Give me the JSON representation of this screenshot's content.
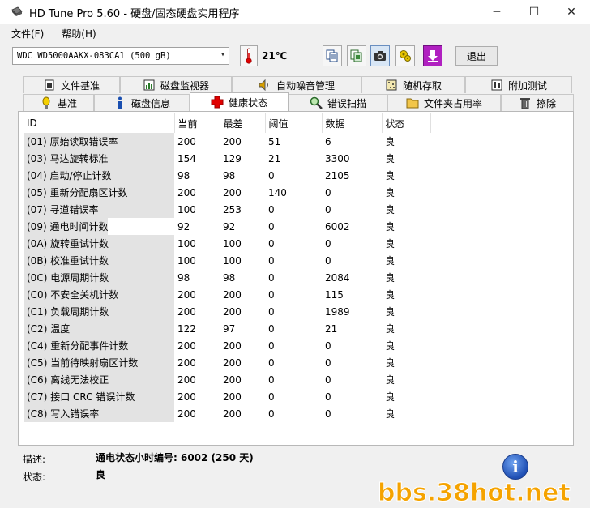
{
  "window": {
    "title": "HD Tune Pro 5.60 - 硬盘/固态硬盘实用程序",
    "minimize": "─",
    "maximize": "☐",
    "close": "✕"
  },
  "menu": [
    "文件(F)",
    "帮助(H)"
  ],
  "toolbar": {
    "drive": "WDC WD5000AAKX-083CA1 (500 gB)",
    "temperature": "21℃",
    "exit_label": "退出",
    "icons": [
      "copy-text-icon",
      "copy-screen-icon",
      "screenshot-icon",
      "options-icon",
      "save-icon"
    ]
  },
  "tabs_top": [
    {
      "label": "文件基准",
      "icon": "file-benchmark-icon"
    },
    {
      "label": "磁盘监视器",
      "icon": "disk-monitor-icon"
    },
    {
      "label": "自动噪音管理",
      "icon": "speaker-icon"
    },
    {
      "label": "随机存取",
      "icon": "random-access-icon"
    },
    {
      "label": "附加测试",
      "icon": "extra-tests-icon"
    }
  ],
  "tabs_bottom": [
    {
      "label": "基准",
      "icon": "benchmark-icon"
    },
    {
      "label": "磁盘信息",
      "icon": "info-icon"
    },
    {
      "label": "健康状态",
      "icon": "health-cross-icon",
      "active": true
    },
    {
      "label": "错误扫描",
      "icon": "magnifier-icon"
    },
    {
      "label": "文件夹占用率",
      "icon": "folder-icon"
    },
    {
      "label": "擦除",
      "icon": "trash-icon"
    }
  ],
  "table": {
    "headers": [
      "ID",
      "当前",
      "最差",
      "阈值",
      "数据",
      "状态"
    ],
    "rows": [
      [
        "(01) 原始读取错误率",
        "200",
        "200",
        "51",
        "6",
        "良"
      ],
      [
        "(03) 马达旋转标准",
        "154",
        "129",
        "21",
        "3300",
        "良"
      ],
      [
        "(04) 启动/停止计数",
        "98",
        "98",
        "0",
        "2105",
        "良"
      ],
      [
        "(05) 重新分配扇区计数",
        "200",
        "200",
        "140",
        "0",
        "良"
      ],
      [
        "(07) 寻道错误率",
        "100",
        "253",
        "0",
        "0",
        "良"
      ],
      [
        "(09) 通电时间计数",
        "92",
        "92",
        "0",
        "6002",
        "良"
      ],
      [
        "(0A) 旋转重试计数",
        "100",
        "100",
        "0",
        "0",
        "良"
      ],
      [
        "(0B) 校准重试计数",
        "100",
        "100",
        "0",
        "0",
        "良"
      ],
      [
        "(0C) 电源周期计数",
        "98",
        "98",
        "0",
        "2084",
        "良"
      ],
      [
        "(C0) 不安全关机计数",
        "200",
        "200",
        "0",
        "115",
        "良"
      ],
      [
        "(C1) 负载周期计数",
        "200",
        "200",
        "0",
        "1989",
        "良"
      ],
      [
        "(C2) 温度",
        "122",
        "97",
        "0",
        "21",
        "良"
      ],
      [
        "(C4) 重新分配事件计数",
        "200",
        "200",
        "0",
        "0",
        "良"
      ],
      [
        "(C5) 当前待映射扇区计数",
        "200",
        "200",
        "0",
        "0",
        "良"
      ],
      [
        "(C6) 离线无法校正",
        "200",
        "200",
        "0",
        "0",
        "良"
      ],
      [
        "(C7) 接口 CRC 错误计数",
        "200",
        "200",
        "0",
        "0",
        "良"
      ],
      [
        "(C8) 写入错误率",
        "200",
        "200",
        "0",
        "0",
        "良"
      ]
    ]
  },
  "details": {
    "desc_label": "描述:",
    "desc_value": "通电状态小时编号: 6002 (250 天)",
    "status_label": "状态:",
    "status_value": "良"
  },
  "watermark": "bbs.38hot.net"
}
